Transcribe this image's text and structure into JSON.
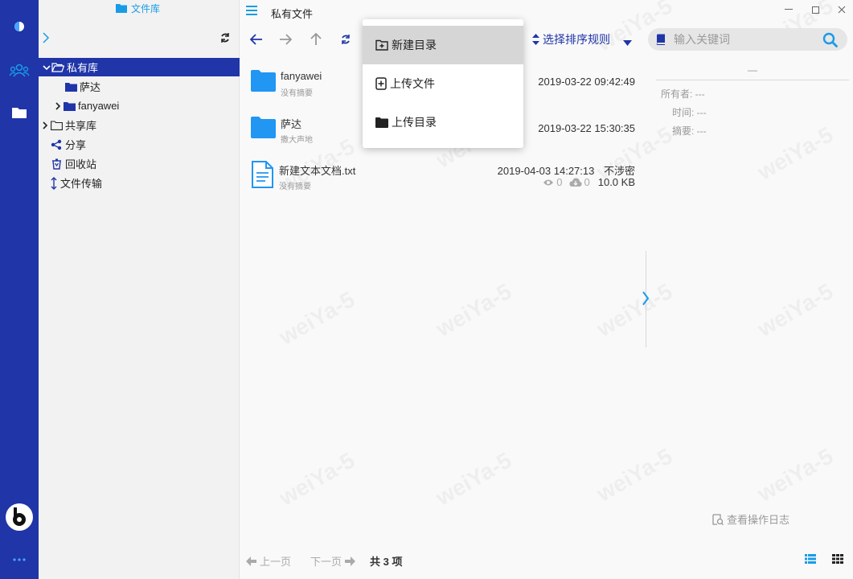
{
  "library_title": "文件库",
  "tree": {
    "items": [
      {
        "label": "私有库",
        "expanded": true,
        "active": true
      },
      {
        "label": "萨达"
      },
      {
        "label": "fanyawei"
      },
      {
        "label": "共享库"
      },
      {
        "label": "分享"
      },
      {
        "label": "回收站"
      },
      {
        "label": "文件传输"
      }
    ]
  },
  "breadcrumb": "私有文件",
  "toolbar": {
    "sort_label": "选择排序规则",
    "search_placeholder": "输入关键词"
  },
  "menu": {
    "items": [
      {
        "label": "新建目录",
        "icon": "folder-plus-icon",
        "hovered": true
      },
      {
        "label": "上传文件",
        "icon": "file-plus-icon"
      },
      {
        "label": "上传目录",
        "icon": "folder-icon"
      }
    ]
  },
  "files": [
    {
      "name": "fanyawei",
      "subtitle": "没有摘要",
      "date": "2019-03-22 09:42:49",
      "type": "folder"
    },
    {
      "name": "萨达",
      "subtitle": "撒大声地",
      "date": "2019-03-22 15:30:35",
      "type": "folder"
    },
    {
      "name": "新建文本文档.txt",
      "subtitle": "没有摘要",
      "date": "2019-04-03 14:27:13",
      "classification": "不涉密",
      "views": "0",
      "downloads": "0",
      "size": "10.0 KB",
      "type": "file"
    }
  ],
  "detail": {
    "dash": "—",
    "owner": "所有者: ---",
    "time": "时间: ---",
    "summary": "摘要: ---"
  },
  "operation_log": "查看操作日志",
  "pager": {
    "prev": "上一页",
    "next": "下一页",
    "total": "共 3 项"
  },
  "watermark": "weiYa-5",
  "colors": {
    "rail": "#1f35a8",
    "accent": "#1a9be6",
    "folder": "#2196f3"
  }
}
